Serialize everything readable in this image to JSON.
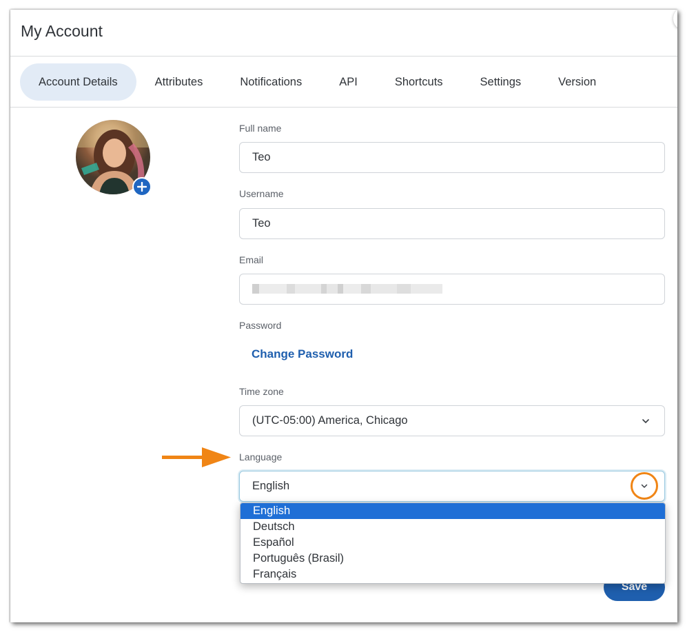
{
  "dialog": {
    "title": "My Account"
  },
  "tabs": [
    {
      "label": "Account Details",
      "active": true
    },
    {
      "label": "Attributes"
    },
    {
      "label": "Notifications"
    },
    {
      "label": "API"
    },
    {
      "label": "Shortcuts"
    },
    {
      "label": "Settings"
    },
    {
      "label": "Version"
    }
  ],
  "form": {
    "full_name": {
      "label": "Full name",
      "value": "Teo"
    },
    "username": {
      "label": "Username",
      "value": "Teo"
    },
    "email": {
      "label": "Email",
      "value": ""
    },
    "password": {
      "label": "Password",
      "link": "Change Password"
    },
    "time_zone": {
      "label": "Time zone",
      "value": "(UTC-05:00) America, Chicago"
    },
    "language": {
      "label": "Language",
      "value": "English",
      "options": [
        "English",
        "Deutsch",
        "Español",
        "Português (Brasil)",
        "Français"
      ],
      "selected": "English"
    }
  },
  "save_button": "Save",
  "colors": {
    "accent": "#1f5fae",
    "highlight": "#f08515",
    "tab_active_bg": "#e2ebf6"
  },
  "icons": [
    "add-icon",
    "chevron-down-icon",
    "arrow-right-icon",
    "close-icon"
  ]
}
